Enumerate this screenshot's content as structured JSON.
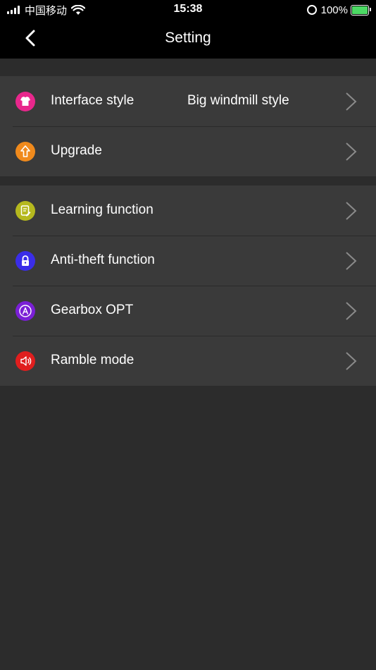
{
  "status_bar": {
    "carrier": "中国移动",
    "time": "15:38",
    "battery": "100%"
  },
  "nav": {
    "title": "Setting"
  },
  "group1": [
    {
      "label": "Interface style",
      "value": "Big windmill style",
      "icon": "shirt-icon",
      "color": "#e8278c"
    },
    {
      "label": "Upgrade",
      "value": "",
      "icon": "upgrade-arrow-icon",
      "color": "#f08a1c"
    }
  ],
  "group2": [
    {
      "label": "Learning function",
      "icon": "learning-icon",
      "color": "#b5b81e"
    },
    {
      "label": "Anti-theft function",
      "icon": "lock-icon",
      "color": "#3a2de8"
    },
    {
      "label": "Gearbox OPT",
      "icon": "gearbox-a-icon",
      "color": "#7a1fd6"
    },
    {
      "label": "Ramble mode",
      "icon": "speaker-icon",
      "color": "#e01e1e"
    }
  ]
}
